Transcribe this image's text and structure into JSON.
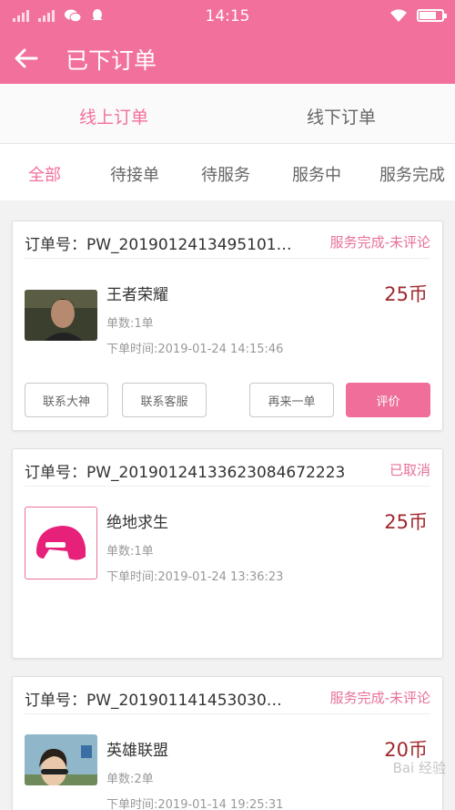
{
  "status_bar": {
    "time": "14:15"
  },
  "header": {
    "title": "已下订单",
    "back_icon": "arrow-left-icon"
  },
  "top_tabs": [
    {
      "label": "线上订单",
      "active": true
    },
    {
      "label": "线下订单",
      "active": false
    }
  ],
  "sub_tabs": [
    {
      "label": "全部",
      "active": true
    },
    {
      "label": "待接单"
    },
    {
      "label": "待服务"
    },
    {
      "label": "服务中"
    },
    {
      "label": "服务完成"
    }
  ],
  "orders": [
    {
      "order_no": "订单号：PW_2019012413495101…",
      "status": "服务完成-未评论",
      "game": "王者荣耀",
      "price": "25币",
      "quantity": "单数:1单",
      "time": "下单时间:2019-01-24 14:15:46",
      "buttons": [
        "联系大神",
        "联系客服",
        "再来一单",
        "评价"
      ]
    },
    {
      "order_no": "订单号：PW_20190124133623084672223",
      "status": "已取消",
      "game": "绝地求生",
      "price": "25币",
      "quantity": "单数:1单",
      "time": "下单时间:2019-01-24 13:36:23",
      "icon": "helmet-icon"
    },
    {
      "order_no": "订单号：PW_2019011414530​30…",
      "status": "服务完成-未评论",
      "game": "英雄联盟",
      "price": "20币",
      "quantity": "单数:2单",
      "time": "下单时间:2019-01-14 19:25:31"
    }
  ],
  "colors": {
    "accent": "#f2709c",
    "price": "#a0282e",
    "status": "#e8709a"
  },
  "watermark": "Bai 经验"
}
